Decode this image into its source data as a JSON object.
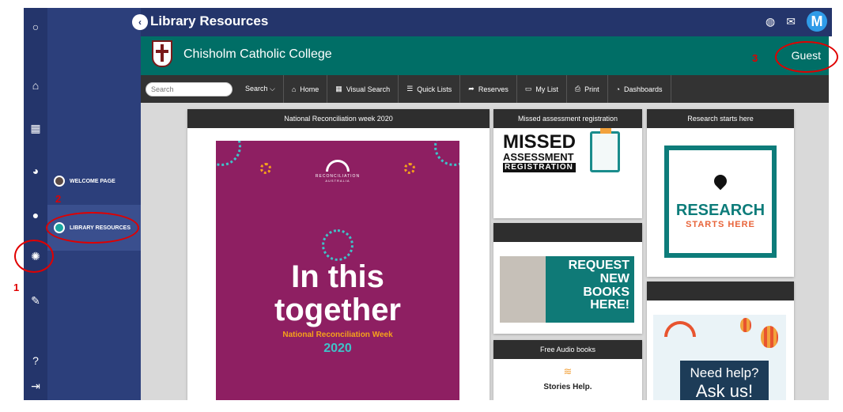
{
  "header": {
    "title": "Library Resources",
    "avatar_letter": "M"
  },
  "college": {
    "name": "Chisholm Catholic College",
    "user": "Guest"
  },
  "subnav": {
    "items": [
      {
        "label": "WELCOME PAGE"
      },
      {
        "label": "LIBRARY RESOURCES"
      }
    ]
  },
  "toolbar": {
    "search_placeholder": "Search",
    "search_button": "Search ⌵",
    "items": [
      {
        "label": "Home",
        "icon": "⌂"
      },
      {
        "label": "Visual Search",
        "icon": "▦"
      },
      {
        "label": "Quick Lists",
        "icon": "☰"
      },
      {
        "label": "Reserves",
        "icon": "➦"
      },
      {
        "label": "My List",
        "icon": "▭"
      },
      {
        "label": "Print",
        "icon": "⎙"
      },
      {
        "label": "Dashboards",
        "icon": "◔"
      }
    ]
  },
  "cards": {
    "reconciliation": {
      "title": "National Reconciliation week 2020",
      "logo_text": "RECONCILIATION",
      "logo_sub": "AUSTRALIA",
      "line1": "In this",
      "line2": "together",
      "subtitle": "National Reconciliation Week",
      "year": "2020"
    },
    "missed": {
      "title": "Missed assessment registration",
      "word1": "MISSED",
      "word2": "ASSESSMENT",
      "word3": "REGISTRATION"
    },
    "research": {
      "title": "Research starts here",
      "word1": "RESEARCH",
      "word2": "STARTS HERE"
    },
    "request": {
      "title": "",
      "line1": "REQUEST",
      "line2": "NEW",
      "line3": "BOOKS",
      "line4": "HERE!"
    },
    "help": {
      "title": "",
      "line1": "Need help?",
      "line2": "Ask us!"
    },
    "audio": {
      "title": "Free Audio books",
      "label": "Stories Help."
    }
  },
  "annotations": {
    "n1": "1",
    "n2": "2",
    "n3": "3"
  },
  "colors": {
    "navy": "#24356b",
    "teal": "#006e66",
    "toolbar": "#333333",
    "annotation": "#e00000"
  }
}
